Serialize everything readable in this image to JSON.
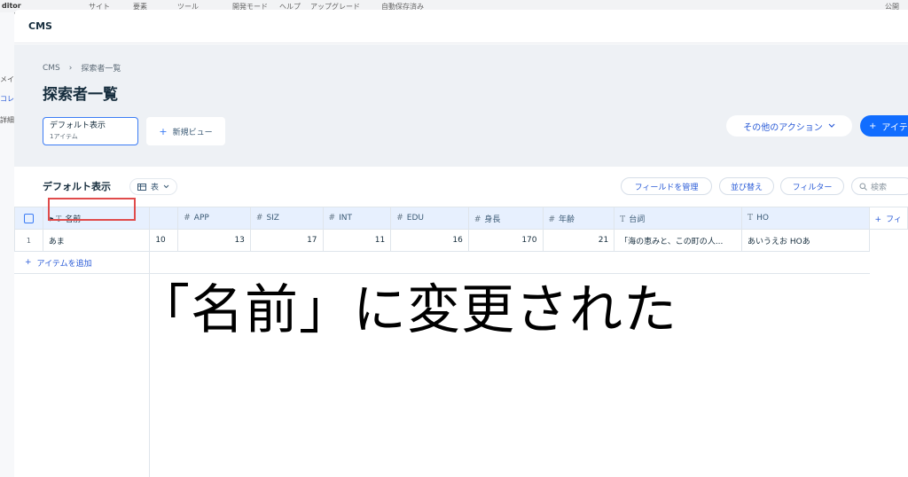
{
  "background": {
    "top_items": [
      "ditor",
      "サイト",
      "要素",
      "ツール",
      "開発モード",
      "ヘルプ",
      "アップグレード",
      "自動保存済み",
      "公開"
    ],
    "left_items": [
      "メイ",
      "コレ",
      "詳細"
    ]
  },
  "modal": {
    "title": "CMS"
  },
  "breadcrumb": {
    "root": "CMS",
    "separator": "›",
    "current": "探索者一覧"
  },
  "page_title": "探索者一覧",
  "views": {
    "default_label": "デフォルト表示",
    "default_count": "1アイテム",
    "new_view_label": "新規ビュー"
  },
  "actions": {
    "more_actions": "その他のアクション",
    "add_item": "アイテ"
  },
  "toolbar": {
    "view_title": "デフォルト表示",
    "layout": "表",
    "manage_fields": "フィールドを管理",
    "sort": "並び替え",
    "filter": "フィルター",
    "search_placeholder": "検索"
  },
  "table": {
    "columns": [
      {
        "type": "text",
        "label": "名前",
        "primary": true
      },
      {
        "type": "none",
        "label": ""
      },
      {
        "type": "number",
        "label": "APP"
      },
      {
        "type": "number",
        "label": "SIZ"
      },
      {
        "type": "number",
        "label": "INT"
      },
      {
        "type": "number",
        "label": "EDU"
      },
      {
        "type": "number",
        "label": "身長"
      },
      {
        "type": "number",
        "label": "年齢"
      },
      {
        "type": "text",
        "label": "台詞"
      },
      {
        "type": "text",
        "label": "HO"
      },
      {
        "type": "add",
        "label": "フィ"
      }
    ],
    "rows": [
      {
        "index": "1",
        "cells": [
          "あま",
          "10",
          "13",
          "17",
          "11",
          "16",
          "170",
          "21",
          "「海の恵みと、この町の人...",
          "あいうえお HOあ",
          ""
        ]
      }
    ],
    "add_item_label": "アイテムを追加"
  },
  "overlay_caption": "「名前」に変更された",
  "colors": {
    "accent": "#116dff",
    "highlight": "#e04b4b",
    "header_bg": "#e7f0fe",
    "head_area": "#eef1f5"
  }
}
